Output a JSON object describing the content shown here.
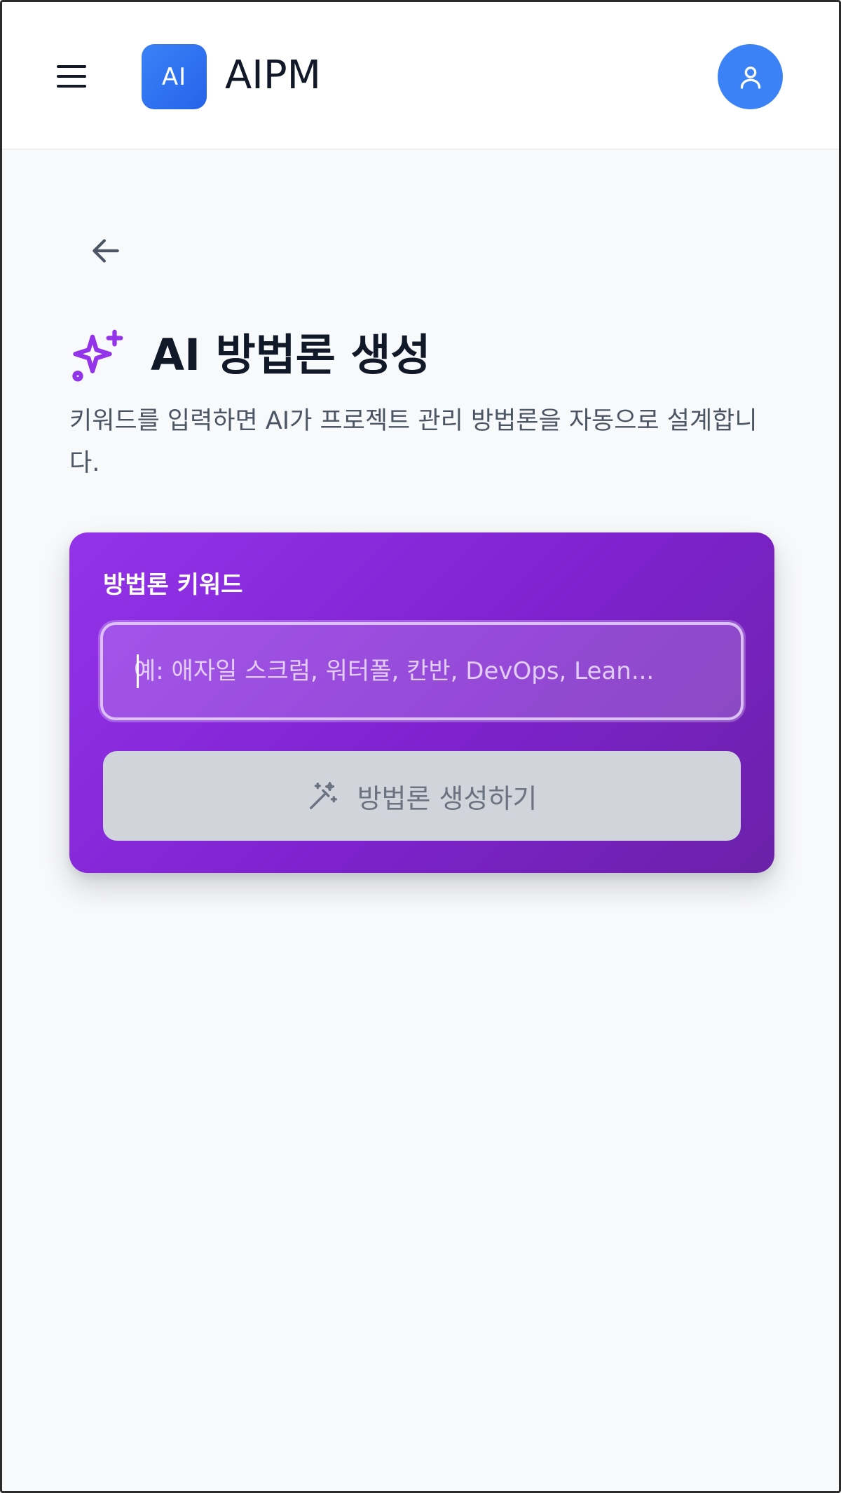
{
  "header": {
    "logo_text": "AI",
    "brand_name": "AIPM"
  },
  "page": {
    "title": "AI 방법론 생성",
    "description": "키워드를 입력하면 AI가 프로젝트 관리 방법론을 자동으로 설계합니다."
  },
  "form": {
    "label": "방법론 키워드",
    "input_value": "",
    "input_placeholder": "예: 애자일 스크럼, 워터폴, 칸반, DevOps, Lean...",
    "submit_label": "방법론 생성하기"
  },
  "icons": {
    "menu": "hamburger-menu-icon",
    "avatar": "user-icon",
    "back": "arrow-left-icon",
    "title": "sparkles-icon",
    "submit": "magic-wand-icon"
  },
  "colors": {
    "brand_blue": "#3b82f6",
    "card_purple_start": "#9333ea",
    "card_purple_end": "#6b21a8",
    "title_icon_purple": "#9333ea",
    "button_disabled_bg": "#d1d5db",
    "button_disabled_text": "#6b7280"
  }
}
